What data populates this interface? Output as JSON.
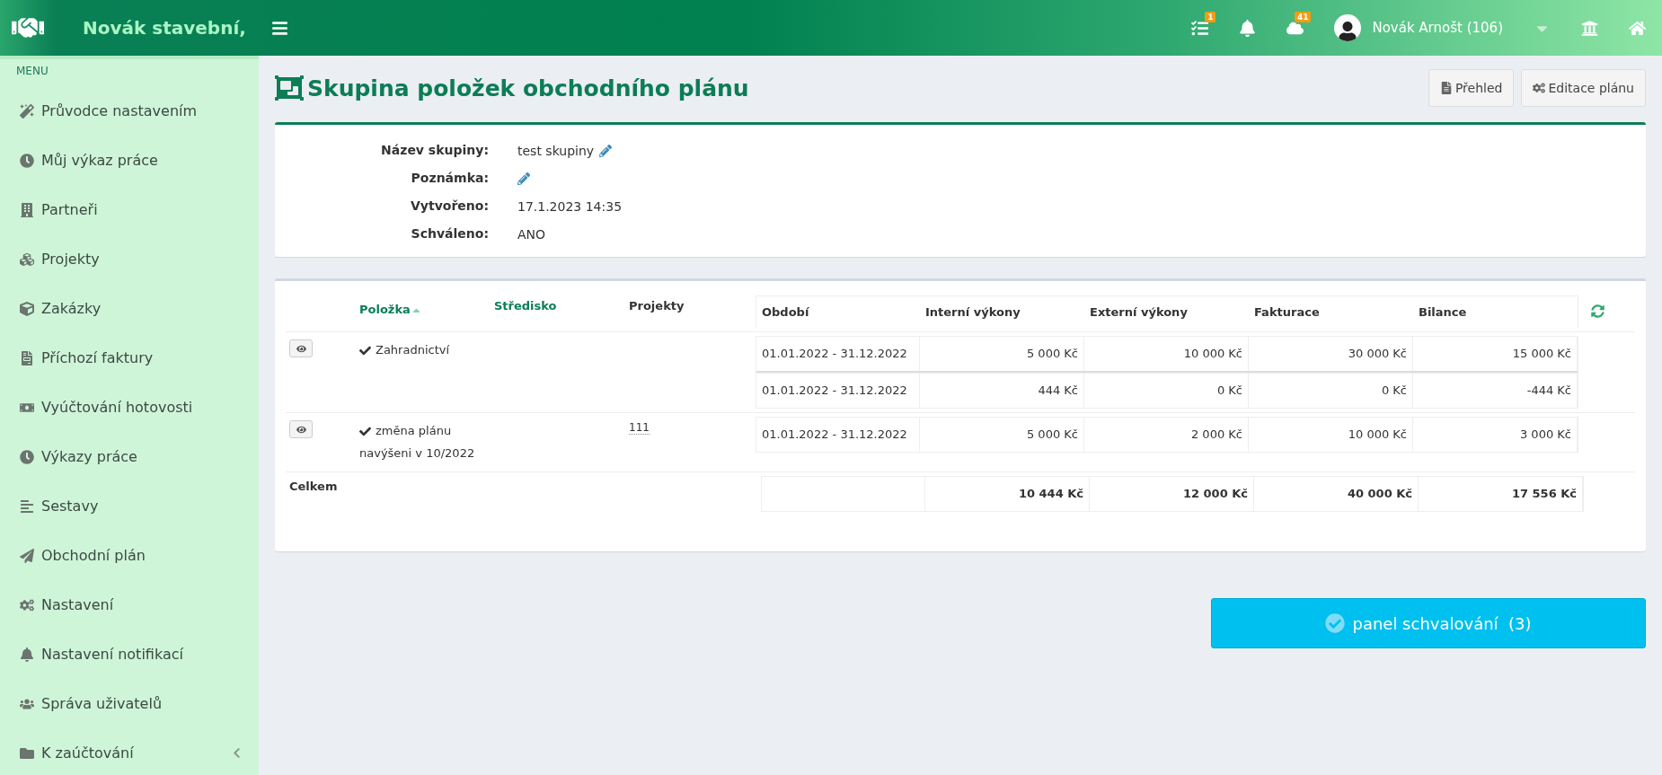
{
  "topbar": {
    "brand": "Novák stavební,",
    "tasks_badge": "1",
    "cloud_badge": "41",
    "user": "Novák Arnošt (106)"
  },
  "sidebar": {
    "menu_label": "MENU",
    "items": [
      {
        "label": "Průvodce nastavením"
      },
      {
        "label": "Můj výkaz práce"
      },
      {
        "label": "Partneři"
      },
      {
        "label": "Projekty"
      },
      {
        "label": "Zakázky"
      },
      {
        "label": "Příchozí faktury"
      },
      {
        "label": "Vyúčtování hotovosti"
      },
      {
        "label": "Výkazy práce"
      },
      {
        "label": "Sestavy"
      },
      {
        "label": "Obchodní plán"
      },
      {
        "label": "Nastavení"
      },
      {
        "label": "Nastavení notifikací"
      },
      {
        "label": "Správa uživatelů"
      },
      {
        "label": "K zaúčtování",
        "expanded": false
      }
    ]
  },
  "page": {
    "title": "Skupina položek obchodního plánu",
    "buttons": [
      "Přehled",
      "Editace plánu"
    ]
  },
  "details": [
    {
      "label": "Název skupiny:",
      "value": "test skupiny",
      "editable": true
    },
    {
      "label": "Poznámka:",
      "editable": true
    },
    {
      "label": "Vytvořeno:",
      "value": "17.1.2023 14:35",
      "editable": false
    },
    {
      "label": "Schváleno:",
      "value": "ANO",
      "editable": false
    }
  ],
  "table": {
    "columns": [
      {
        "label": "Položka",
        "sortable": true,
        "sorted": true
      },
      {
        "label": "Středisko",
        "sortable": true,
        "sorted": false
      },
      {
        "label": "Projekty",
        "sortable": false,
        "sorted": false
      }
    ],
    "period_columns": [
      "Období",
      "Interní výkony",
      "Externí výkony",
      "Fakturace",
      "Bilance"
    ],
    "rows": [
      {
        "item": "Zahradnictví",
        "approved": true,
        "periods": [
          [
            "01.01.2022 - 31.12.2022",
            "5 000 Kč",
            "10 000 Kč",
            "30 000 Kč",
            "15 000 Kč"
          ],
          [
            "01.01.2022 - 31.12.2022",
            "444 Kč",
            "0 Kč",
            "0 Kč",
            "-444 Kč"
          ]
        ]
      },
      {
        "item": "změna plánu navýšeni v 10/2022",
        "approved": true,
        "projects": "111",
        "periods": [
          [
            "01.01.2022 - 31.12.2022",
            "5 000 Kč",
            "2 000 Kč",
            "10 000 Kč",
            "3 000 Kč"
          ]
        ]
      }
    ],
    "totals": {
      "label": "Celkem",
      "values": [
        "10 444 Kč",
        "12 000 Kč",
        "40 000 Kč",
        "17 556 Kč"
      ]
    }
  },
  "approval_button": {
    "label": "panel schvalování",
    "count": "(3)"
  }
}
